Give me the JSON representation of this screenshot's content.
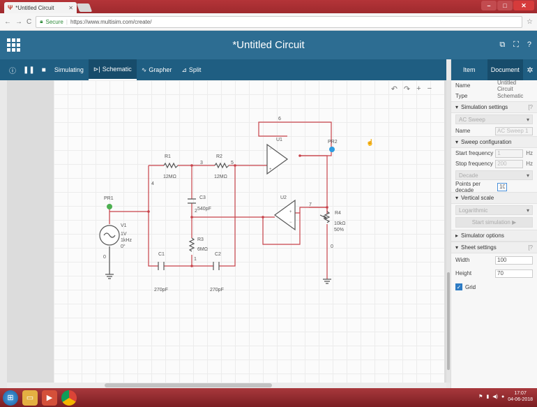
{
  "browser": {
    "tab_title": "*Untitled Circuit",
    "secure_label": "Secure",
    "url": "https://www.multisim.com/create/"
  },
  "app": {
    "title": "*Untitled Circuit"
  },
  "toolbar": {
    "simulating": "Simulating",
    "schematic": "Schematic",
    "grapher": "Grapher",
    "split": "Split"
  },
  "schematic": {
    "R1": {
      "name": "R1",
      "value": "12MΩ"
    },
    "R2": {
      "name": "R2",
      "value": "12MΩ"
    },
    "R3": {
      "name": "R3",
      "value": "6MΩ"
    },
    "R4": {
      "name": "R4",
      "value": "10kΩ",
      "setting": "50%"
    },
    "C1": {
      "name": "C1",
      "value": "270pF"
    },
    "C2": {
      "name": "C2",
      "value": "270pF"
    },
    "C3": {
      "name": "C3",
      "value": "540pF"
    },
    "U1": "U1",
    "U2": "U2",
    "V1": {
      "name": "V1",
      "amp": "1V",
      "freq": "1kHz",
      "phase": "0°"
    },
    "PR1": "PR1",
    "PR2": "PR2",
    "nodes": {
      "n0a": "0",
      "n0b": "0",
      "n1": "1",
      "n2": "2",
      "n3": "3",
      "n4": "4",
      "n5": "5",
      "n6": "6",
      "n7": "7"
    }
  },
  "panel": {
    "tab_item": "Item",
    "tab_document": "Document",
    "name_label": "Name",
    "name_value": "Untitled Circuit",
    "type_label": "Type",
    "type_value": "Schematic",
    "sim_settings": "Simulation settings",
    "analysis": "AC Sweep",
    "analysis_name_label": "Name",
    "analysis_name_value": "AC Sweep 1",
    "sweep_config": "Sweep configuration",
    "start_freq_label": "Start frequency",
    "start_freq_value": "1",
    "stop_freq_label": "Stop frequency",
    "stop_freq_value": "200",
    "freq_unit": "Hz",
    "sweep_type": "Decade",
    "points_label": "Points per decade",
    "points_value": "10",
    "vertical_scale": "Vertical scale",
    "scale_type": "Logarithmic",
    "start_sim": "Start simulation ▶",
    "sim_options": "Simulator options",
    "sheet_settings": "Sheet settings",
    "width_label": "Width",
    "width_value": "100",
    "height_label": "Height",
    "height_value": "70",
    "grid_label": "Grid"
  },
  "taskbar": {
    "time": "17:07",
    "date": "04-06-2018"
  }
}
